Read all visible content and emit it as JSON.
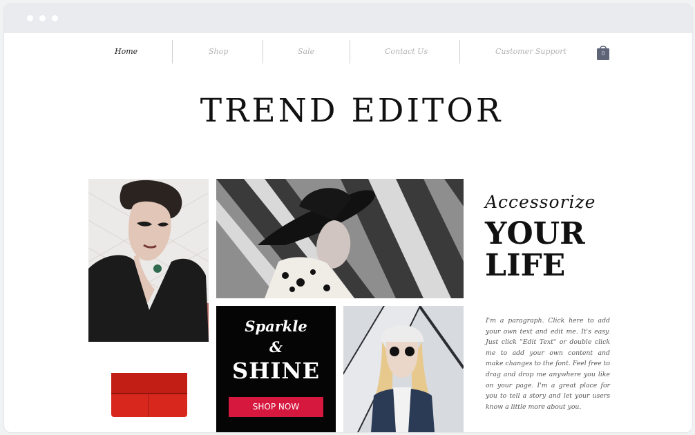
{
  "nav": {
    "items": [
      {
        "label": "Home"
      },
      {
        "label": "Shop"
      },
      {
        "label": "Sale"
      },
      {
        "label": "Contact Us"
      },
      {
        "label": "Customer Support"
      }
    ],
    "cart_count": "0"
  },
  "site_title": "TREND EDITOR",
  "promo": {
    "line1": "Sparkle",
    "line2": "&",
    "line3": "SHINE",
    "button": "SHOP NOW"
  },
  "feature": {
    "line1": "Accessorize",
    "line2": "YOUR",
    "line3": "LIFE"
  },
  "paragraph": "I'm a paragraph. Click here to add your own text and edit me. It's easy. Just click \"Edit Text\" or double click me to add your own content and make changes to the font. Feel free to drag and drop me anywhere you like on your page. I'm a great place for you to tell a story and let your users know a little more about you.",
  "colors": {
    "accent": "#d6173e",
    "titlebar": "#e9ebee",
    "text_dark": "#111111",
    "nav_muted": "#b2b2b2"
  },
  "icons": {
    "cart": "shopping-bag-icon"
  }
}
